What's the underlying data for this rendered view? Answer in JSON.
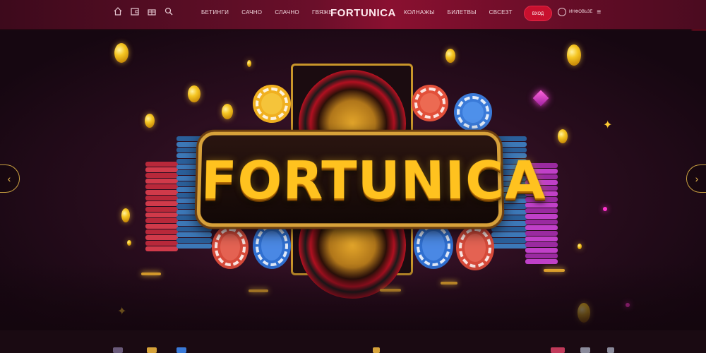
{
  "nav": {
    "icons": [
      "home-icon",
      "wallet-icon",
      "gift-icon",
      "search-icon"
    ],
    "links_left": [
      "Бетинги",
      "Сачно",
      "Слачно",
      "Гвяже"
    ],
    "logo": "FORTUNICA",
    "links_right": [
      "Колнажы",
      "Билетвы",
      "Свсезт"
    ],
    "cta_label": "Вход",
    "account_label": "Инфовьзе",
    "menu_icon": "menu-icon"
  },
  "side_tab_label": "",
  "hero": {
    "title": "FORTUNICA",
    "prev_icon": "‹",
    "next_icon": "›"
  },
  "colors": {
    "nav_bg": "#6b0f2a",
    "accent": "#c8102e",
    "gold": "#ffc21f",
    "hero_bg": "#2a0d1e"
  }
}
